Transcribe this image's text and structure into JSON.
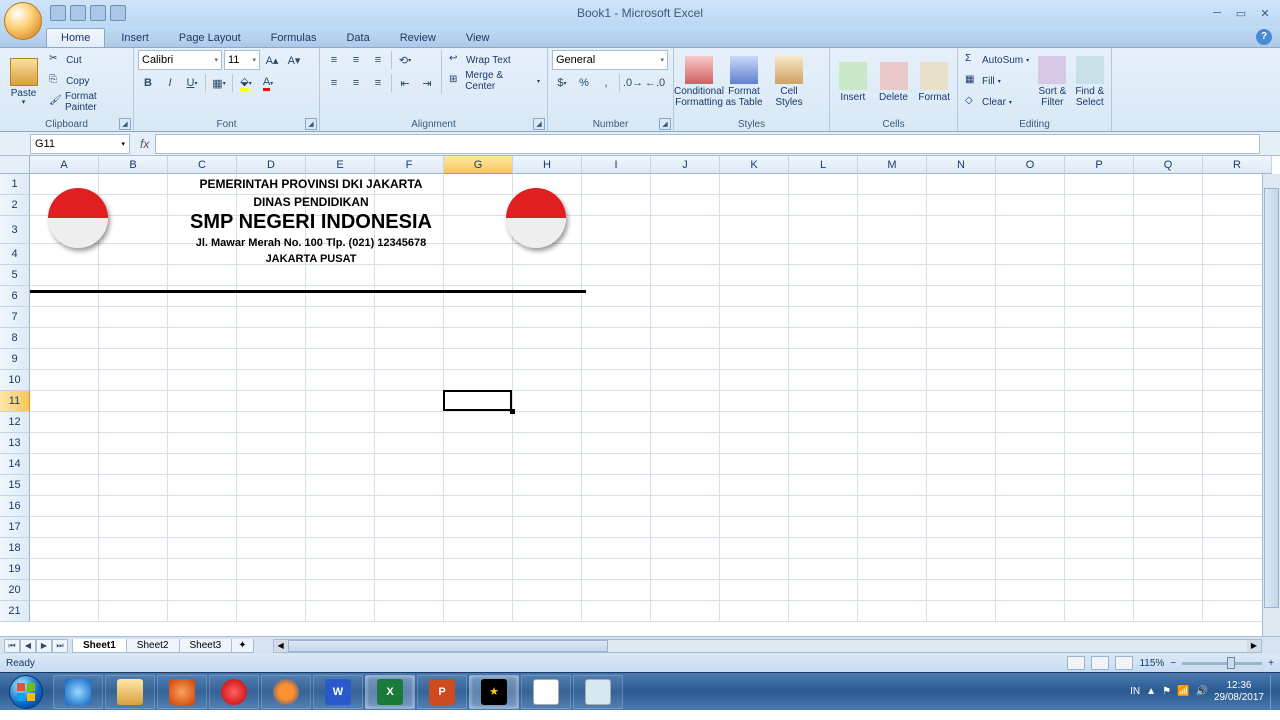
{
  "title": "Book1 - Microsoft Excel",
  "tabs": [
    "Home",
    "Insert",
    "Page Layout",
    "Formulas",
    "Data",
    "Review",
    "View"
  ],
  "ribbon": {
    "clipboard": {
      "label": "Clipboard",
      "paste": "Paste",
      "cut": "Cut",
      "copy": "Copy",
      "fmt": "Format Painter"
    },
    "font": {
      "label": "Font",
      "name": "Calibri",
      "size": "11"
    },
    "alignment": {
      "label": "Alignment",
      "wrap": "Wrap Text",
      "merge": "Merge & Center"
    },
    "number": {
      "label": "Number",
      "format": "General"
    },
    "styles": {
      "label": "Styles",
      "cond": "Conditional Formatting",
      "table": "Format as Table",
      "cell": "Cell Styles"
    },
    "cells": {
      "label": "Cells",
      "insert": "Insert",
      "delete": "Delete",
      "format": "Format"
    },
    "editing": {
      "label": "Editing",
      "sum": "AutoSum",
      "fill": "Fill",
      "clear": "Clear",
      "sort": "Sort & Filter",
      "find": "Find & Select"
    }
  },
  "namebox": "G11",
  "columns": [
    "A",
    "B",
    "C",
    "D",
    "E",
    "F",
    "G",
    "H",
    "I",
    "J",
    "K",
    "L",
    "M",
    "N",
    "O",
    "P",
    "Q",
    "R"
  ],
  "rows": [
    1,
    2,
    3,
    4,
    5,
    6,
    7,
    8,
    9,
    10,
    11,
    12,
    13,
    14,
    15,
    16,
    17,
    18,
    19,
    20,
    21
  ],
  "selected": {
    "col": "G",
    "row": 11
  },
  "doc": {
    "line1": "PEMERINTAH PROVINSI DKI JAKARTA",
    "line2": "DINAS PENDIDIKAN",
    "line3": "SMP NEGERI INDONESIA",
    "line4": "Jl. Mawar Merah No. 100 Tlp. (021) 12345678",
    "line5": "JAKARTA PUSAT"
  },
  "sheets": [
    "Sheet1",
    "Sheet2",
    "Sheet3"
  ],
  "status": "Ready",
  "zoom": "115%",
  "lang": "IN",
  "time": "12:36",
  "date": "29/08/2017"
}
